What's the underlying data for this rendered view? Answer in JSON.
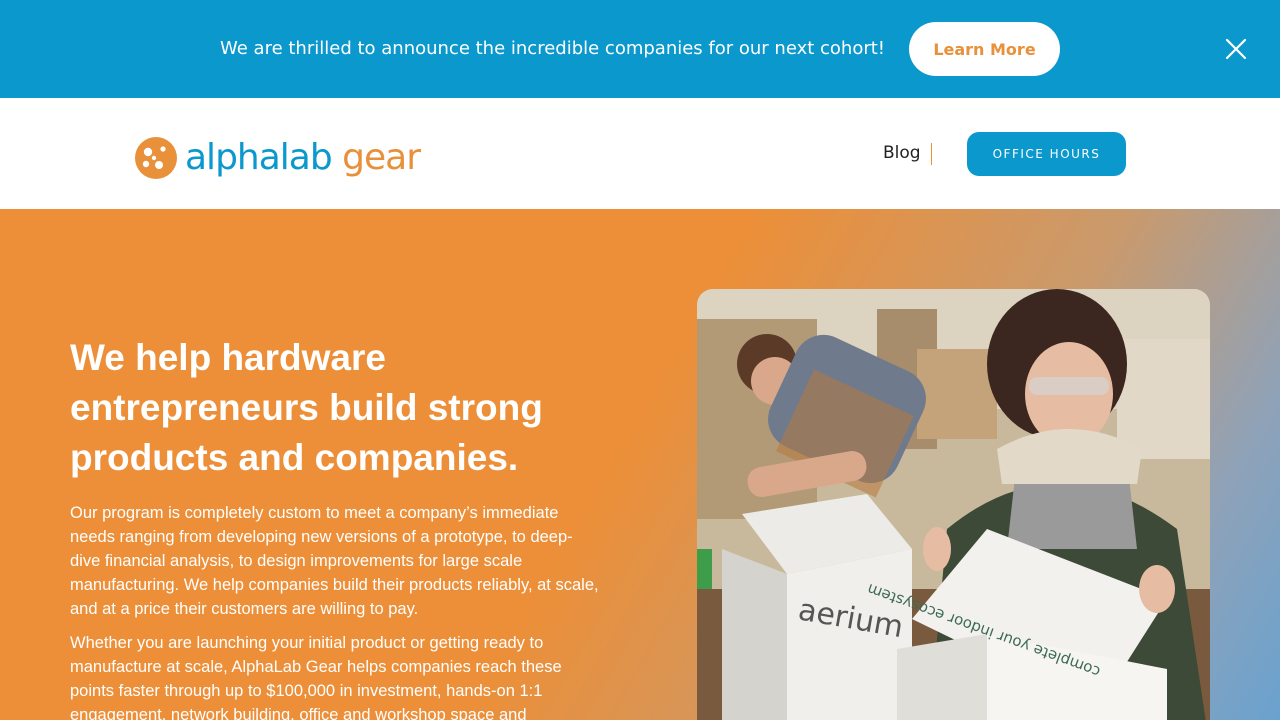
{
  "announcement": {
    "text": "We are thrilled to announce the incredible companies for our next cohort!",
    "button_label": "Learn More",
    "close_icon": "close-icon"
  },
  "header": {
    "logo_alpha": "alphalab",
    "logo_gear": "gear",
    "nav": {
      "blog_label": "Blog",
      "office_hours_label": "OFFICE HOURS"
    }
  },
  "hero": {
    "title": "We help hardware entrepreneurs build strong products and companies.",
    "paragraph1": "Our program is completely custom to meet a company’s immediate needs ranging from developing new versions of a prototype, to deep-dive financial analysis, to design improvements for large scale manufacturing. We help companies build their products reliably, at scale, and at a price their customers are willing to pay.",
    "paragraph2": "Whether you are launching your initial product or getting ready to manufacture at scale, AlphaLab Gear helps companies reach these points faster through up to $100,000 in investment, hands-on 1:1 engagement, network building, office and workshop space and",
    "photo_box_brand": "aerium",
    "photo_box_tagline": "complete your indoor ecosystem"
  },
  "colors": {
    "brand_blue": "#0a98cd",
    "brand_orange": "#e8903a"
  }
}
